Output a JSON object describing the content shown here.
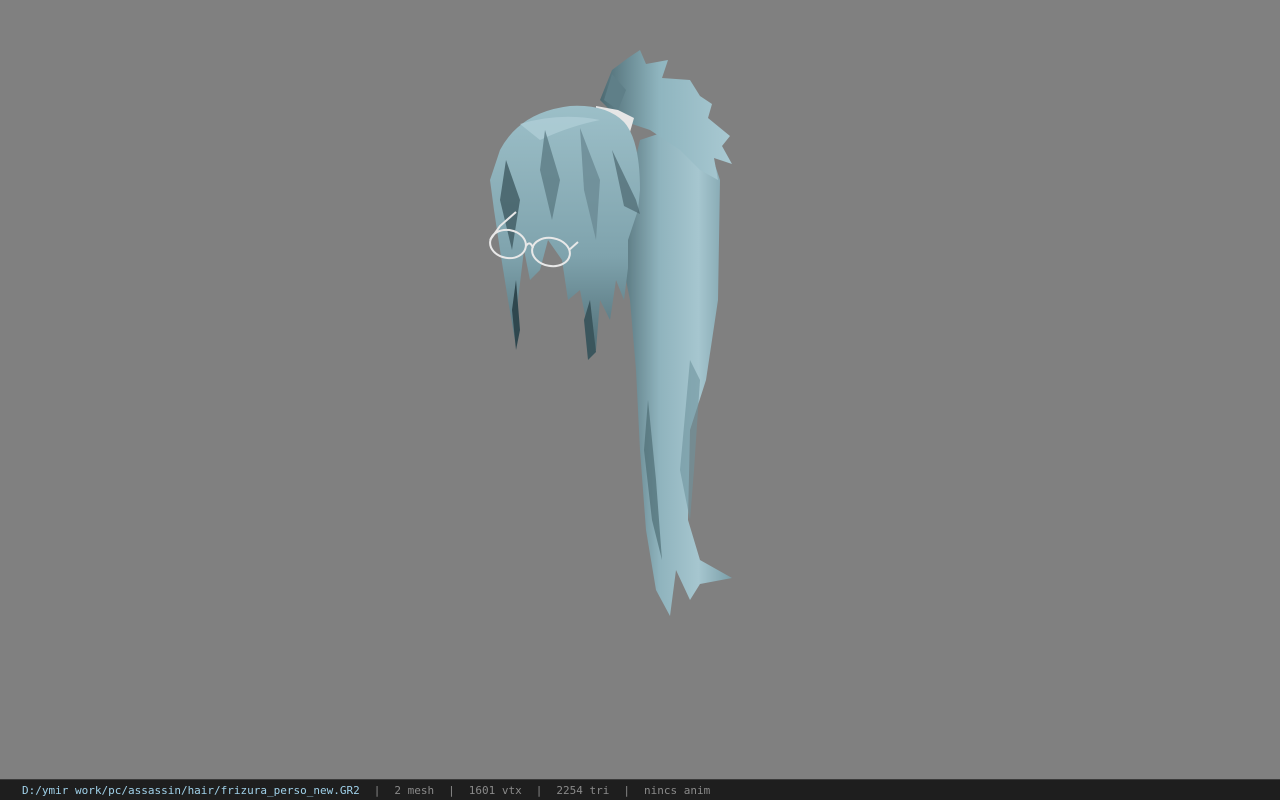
{
  "viewport": {
    "background_color": "#808080",
    "model_name": "hair-with-glasses-model",
    "hair_color": "#8fb5bf",
    "hair_shadow_color": "#4d6a72",
    "glasses_color": "#e0e0e0"
  },
  "status_bar": {
    "file_path": "D:/ymir work/pc/assassin/hair/frizura_perso_new.GR2",
    "separator": "|",
    "mesh_count": "2 mesh",
    "vertex_count": "1601 vtx",
    "triangle_count": "2254 tri",
    "anim_status": "nincs anim",
    "path_color": "#9fd0e8",
    "text_color": "#8a8a8a",
    "background_color": "#1e1e1e"
  }
}
